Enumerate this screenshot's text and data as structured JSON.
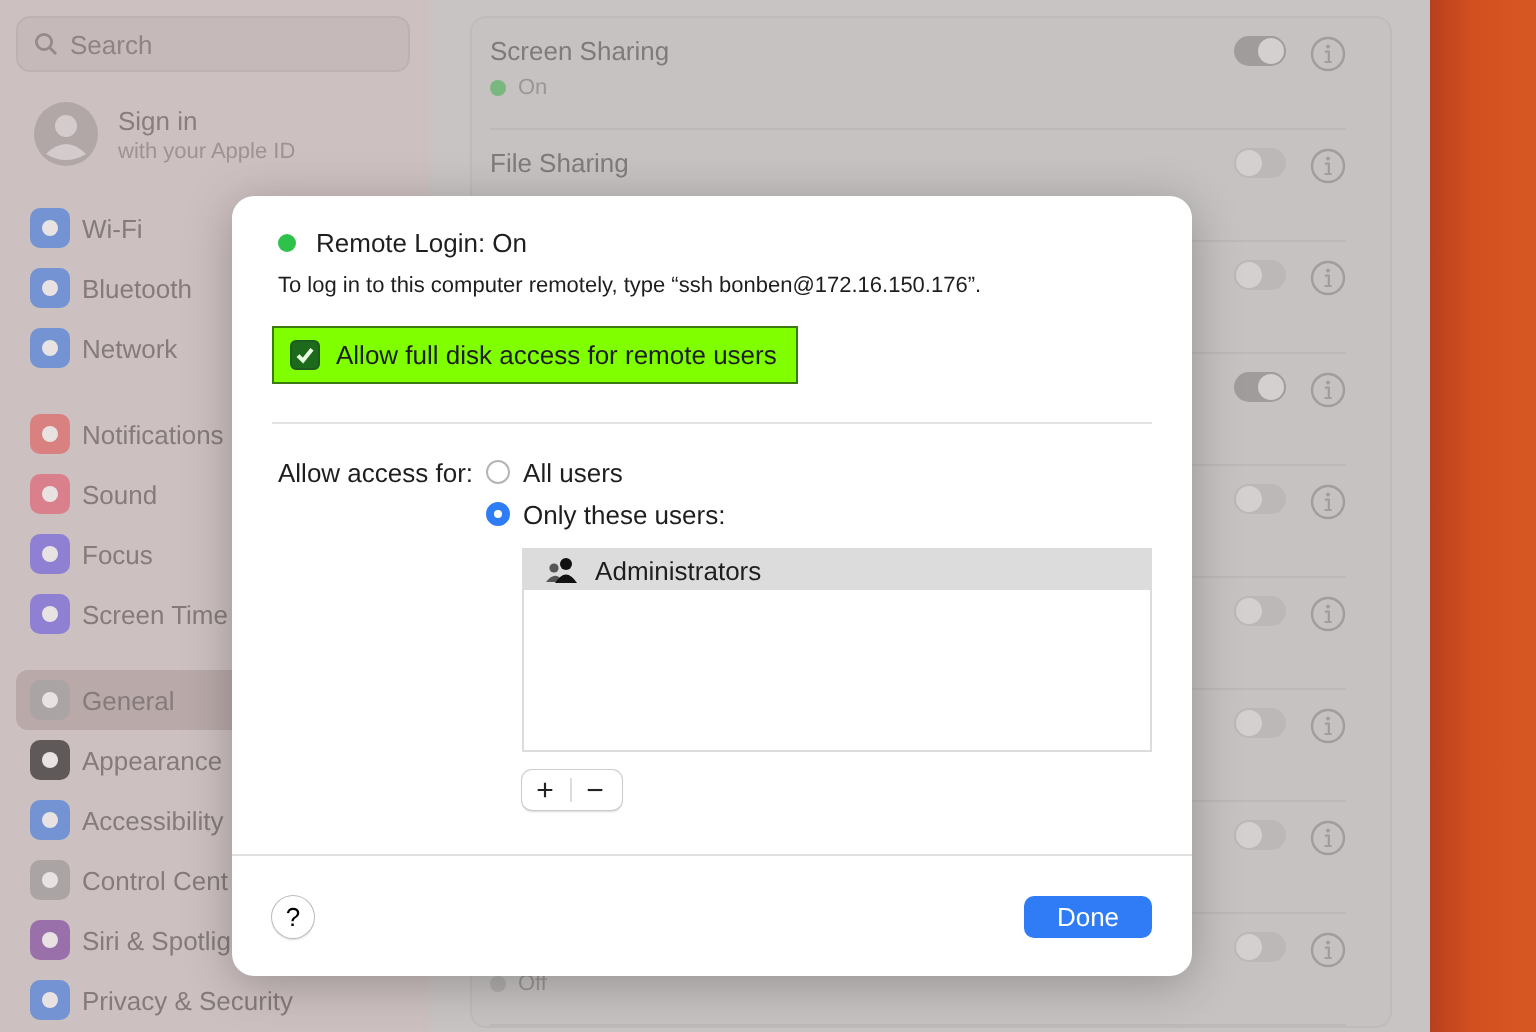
{
  "sidebar": {
    "search": {
      "placeholder": "Search"
    },
    "account": {
      "title": "Sign in",
      "subtitle": "with your Apple ID"
    },
    "groups": [
      {
        "items": [
          {
            "label": "Wi-Fi",
            "color": "#7393d3",
            "selected": false
          },
          {
            "label": "Bluetooth",
            "color": "#7393d3",
            "selected": false
          },
          {
            "label": "Network",
            "color": "#7393d3",
            "selected": false
          }
        ]
      },
      {
        "items": [
          {
            "label": "Notifications",
            "color": "#d98080",
            "selected": false
          },
          {
            "label": "Sound",
            "color": "#d9808c",
            "selected": false
          },
          {
            "label": "Focus",
            "color": "#8f80d3",
            "selected": false
          },
          {
            "label": "Screen Time",
            "color": "#8f80d3",
            "selected": false
          }
        ]
      },
      {
        "items": [
          {
            "label": "General",
            "color": "#aaa4a4",
            "selected": true
          },
          {
            "label": "Appearance",
            "color": "#5f5959",
            "selected": false
          },
          {
            "label": "Accessibility",
            "color": "#7393d3",
            "selected": false
          },
          {
            "label": "Control Cent",
            "color": "#aaa4a4",
            "selected": false
          },
          {
            "label": "Siri & Spotlig",
            "color": "#9a70aa",
            "selected": false
          },
          {
            "label": "Privacy & Security",
            "color": "#7393d3",
            "selected": false
          }
        ]
      }
    ]
  },
  "services": [
    {
      "title": "Screen Sharing",
      "status": "On",
      "on": true
    },
    {
      "title": "File Sharing",
      "on": false
    },
    {
      "on": false
    },
    {
      "on": true
    },
    {
      "on": false
    },
    {
      "on": false
    },
    {
      "on": false
    },
    {
      "on": false
    },
    {
      "status": "Off",
      "on": false
    }
  ],
  "dialog": {
    "title": "Remote Login: On",
    "on": true,
    "instructions": "To log in to this computer remotely, type “ssh bonben@172.16.150.176”.",
    "full_disk_access": {
      "label": "Allow full disk access for remote users",
      "checked": true
    },
    "access_label": "Allow access for:",
    "options": [
      {
        "label": "All users",
        "selected": false
      },
      {
        "label": "Only these users:",
        "selected": true
      }
    ],
    "users": [
      {
        "name": "Administrators",
        "selected": true
      }
    ],
    "add": "+",
    "remove": "−",
    "help": "?",
    "done": "Done"
  }
}
